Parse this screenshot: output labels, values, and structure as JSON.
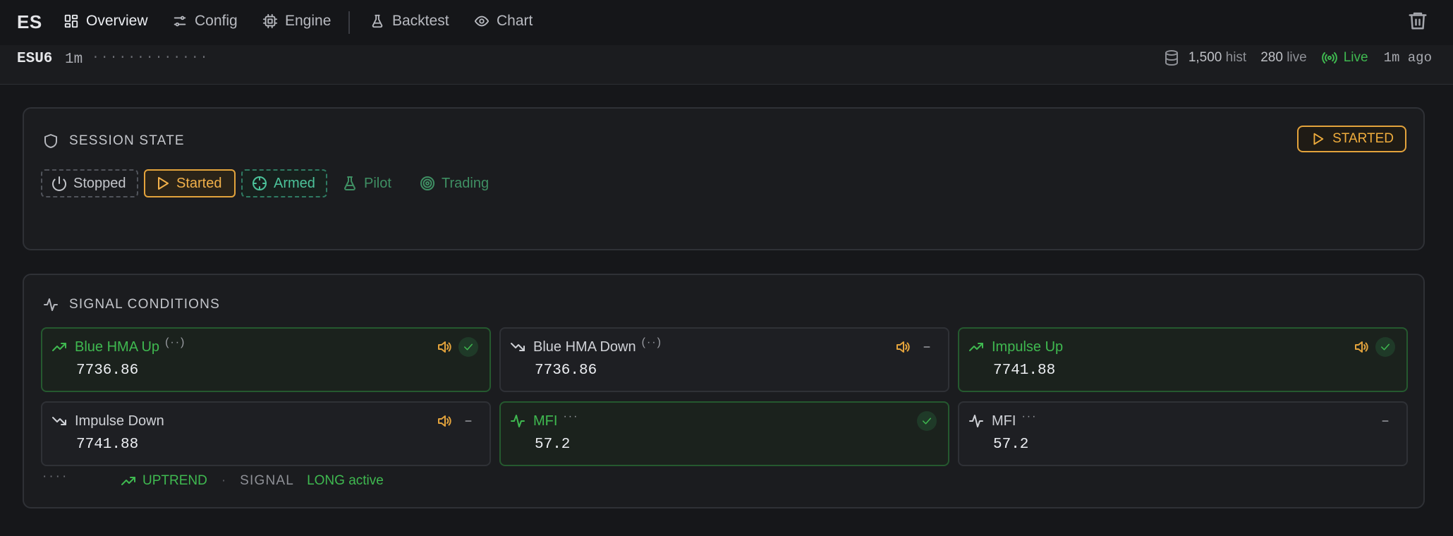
{
  "header": {
    "symbol": "ES",
    "nav": [
      {
        "label": "Overview",
        "icon": "grid-icon",
        "active": true
      },
      {
        "label": "Config",
        "icon": "sliders-icon"
      },
      {
        "label": "Engine",
        "icon": "cpu-icon"
      },
      {
        "label": "Backtest",
        "icon": "flask-icon"
      },
      {
        "label": "Chart",
        "icon": "eye-icon"
      }
    ],
    "delete_icon": "trash-icon"
  },
  "subheader": {
    "contract": "ESU6",
    "timeframe": "1m",
    "placeholder_dots": "·············",
    "hist_count": "1,500",
    "hist_label": "hist",
    "live_count": "280",
    "live_label": "live",
    "status": "Live",
    "updated": "1m ago"
  },
  "session": {
    "title": "SESSION STATE",
    "current_state": "STARTED",
    "states": [
      {
        "label": "Stopped",
        "icon": "power-icon"
      },
      {
        "label": "Started",
        "icon": "play-icon"
      },
      {
        "label": "Armed",
        "icon": "crosshair-icon"
      },
      {
        "label": "Pilot",
        "icon": "flask-icon"
      },
      {
        "label": "Trading",
        "icon": "target-icon"
      }
    ]
  },
  "signals": {
    "title": "SIGNAL CONDITIONS",
    "items": [
      {
        "name": "Blue HMA Up",
        "suffix": "(··)",
        "value": "7736.86",
        "active": true
      },
      {
        "name": "Blue HMA Down",
        "suffix": "(··)",
        "value": "7736.86",
        "active": false
      },
      {
        "name": "Impulse Up",
        "suffix": "",
        "value": "7741.88",
        "active": true
      },
      {
        "name": "Impulse Down",
        "suffix": "",
        "value": "7741.88",
        "active": false
      },
      {
        "name": "MFI",
        "suffix": "···",
        "value": "57.2",
        "active": true
      },
      {
        "name": "MFI",
        "suffix": "···",
        "value": "57.2",
        "active": false
      }
    ],
    "footer": {
      "dots": "····",
      "trend": "UPTREND",
      "separator": "·",
      "signal_label": "SIGNAL",
      "signal_value": "LONG active"
    }
  },
  "colors": {
    "accent_amber": "#e3a33c",
    "accent_green": "#3fb950",
    "armed_teal": "#4cc29a",
    "background": "#16171a"
  }
}
